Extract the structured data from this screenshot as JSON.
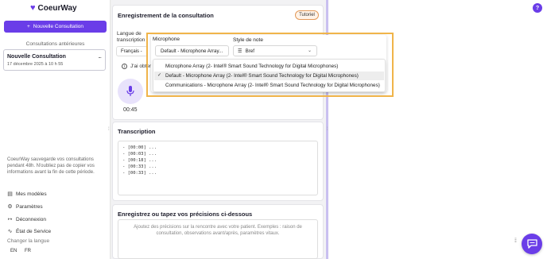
{
  "brand": {
    "name": "CoeurWay",
    "accent": "#6a3de8"
  },
  "sidebar": {
    "new_button": "Nouvelle Consultation",
    "previous_title": "Consultations antérieures",
    "consultation": {
      "title": "Nouvelle Consultation",
      "date": "17 décembre 2025 à 10 h 55",
      "menu": "..."
    },
    "notice": "CoeurWay sauvegarde vos consultations pendant 48h. N'oubliez pas de copier vos informations avant la fin de cette période.",
    "links": [
      {
        "label": "Mes modèles",
        "icon": "document-icon"
      },
      {
        "label": "Paramètres",
        "icon": "gear-icon"
      },
      {
        "label": "Déconnexion",
        "icon": "logout-icon"
      },
      {
        "label": "État de Service",
        "icon": "pulse-icon"
      }
    ],
    "change_language": "Changer la langue",
    "languages": [
      "EN",
      "FR"
    ]
  },
  "recording": {
    "title": "Enregistrement de la consultation",
    "tutorial": "Tutoriel",
    "lang_label_1": "Langue de",
    "lang_label_2": "transcription",
    "lang_value": "Français -",
    "info_text": "J'ai obtenu",
    "timer": "00:45"
  },
  "popup": {
    "mic_label": "Microphone",
    "mic_value": "Default - Microphone Array...",
    "note_label": "Style de note",
    "note_value": "Bref",
    "options": [
      {
        "label": "Microphone Array (2- Intel® Smart Sound Technology for Digital Microphones)",
        "selected": false
      },
      {
        "label": "Default - Microphone Array (2- Intel® Smart Sound Technology for Digital Microphones)",
        "selected": true
      },
      {
        "label": "Communications - Microphone Array (2- Intel® Smart Sound Technology for Digital Microphones)",
        "selected": false
      }
    ]
  },
  "transcription": {
    "title": "Transcription",
    "lines": [
      "- [00:00] ...",
      "- [00:03] ...",
      "- [00:18] ...",
      "- [00:33] ...",
      "- [00:33] ..."
    ]
  },
  "details": {
    "title": "Enregistrez ou tapez vos précisions ci-dessous",
    "placeholder": "Ajoutez des précisions sur la rencontre avec votre patient. Exemples : raison de consultation, observations avant/après, paramètres vitaux."
  },
  "help": "?"
}
